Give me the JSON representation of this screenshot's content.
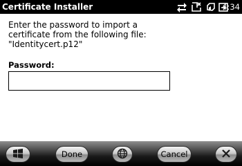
{
  "status_bar": {
    "app_title": "Certificate Installer",
    "time": "4:34",
    "icons": [
      "network-data-icon",
      "phone-signal-off-icon",
      "volume-icon",
      "battery-charging-icon"
    ]
  },
  "dialog": {
    "prompt_lines": [
      "Enter the password to import a",
      "certificate from the following file:",
      "\"Identitycert.p12\""
    ],
    "password_label": "Password:",
    "password_value": ""
  },
  "soft_keys": {
    "start_icon": "windows-start-icon",
    "done_label": "Done",
    "sip_icon": "keyboard-globe-icon",
    "cancel_label": "Cancel",
    "close_icon": "close-icon"
  },
  "colors": {
    "title_bar": "#000000",
    "background": "#ffffff",
    "soft_bar": "#1a1a1a"
  }
}
